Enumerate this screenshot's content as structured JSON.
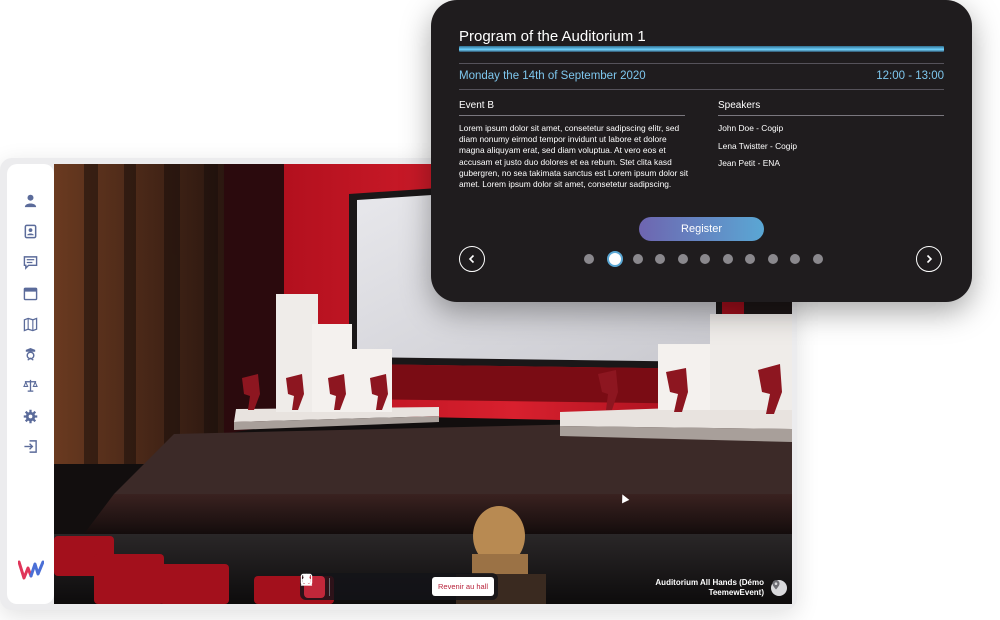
{
  "sidebar": {
    "icons": [
      "user-icon",
      "contacts-icon",
      "chat-icon",
      "calendar-icon",
      "map-icon",
      "award-icon",
      "scale-icon",
      "gear-icon",
      "logout-icon"
    ],
    "logo": "W"
  },
  "toolbar": {
    "items": [
      "stage-icon",
      "award-icon",
      "bell-icon",
      "chat-icon",
      "pin-icon"
    ],
    "back_label": "Revenir au hall"
  },
  "location": {
    "line1": "Auditorium All Hands (Démo",
    "line2": "TeemewEvent)"
  },
  "program": {
    "title": "Program of the Auditorium 1",
    "date": "Monday the 14th of September 2020",
    "time": "12:00 - 13:00",
    "event_title": "Event B",
    "description": "Lorem ipsum dolor sit amet, consetetur sadipscing elitr, sed diam nonumy eirmod tempor invidunt ut labore et dolore magna aliquyam erat, sed diam voluptua. At vero eos et accusam et justo duo dolores et ea rebum. Stet clita kasd gubergren, no sea takimata sanctus est Lorem ipsum dolor sit amet. Lorem ipsum dolor sit amet, consetetur sadipscing.",
    "speakers_title": "Speakers",
    "speakers": [
      "John Doe - Cogip",
      "Lena Twistter - Cogip",
      "Jean Petit - ENA"
    ],
    "register_label": "Register",
    "page_dots": 11,
    "active_dot": 2
  },
  "colors": {
    "accent_blue": "#7ec7ee",
    "accent_red": "#c1273a",
    "popup_bg": "#1f1c1e"
  }
}
